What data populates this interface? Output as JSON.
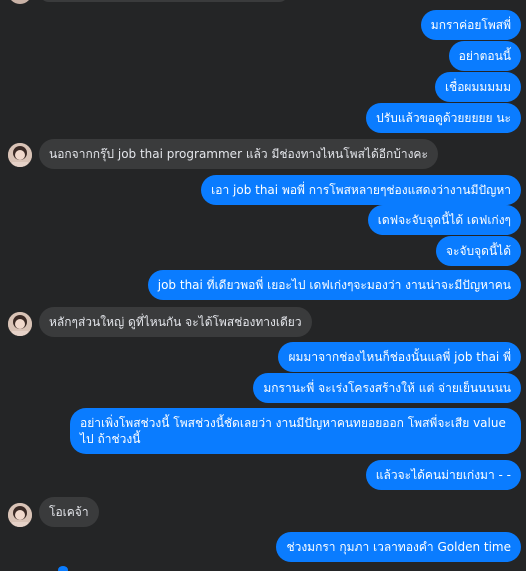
{
  "messages": [
    {
      "sender": "me",
      "text": "มกราค่อยโพสพี่"
    },
    {
      "sender": "me",
      "text": "อย่าตอนนี้"
    },
    {
      "sender": "me",
      "text": "เชื่อผมมมมม"
    },
    {
      "sender": "me",
      "text": "ปรับแล้วขอดูด้วยยยยย นะ"
    },
    {
      "sender": "them",
      "text": "นอกจากกรุ๊ป job thai programmer แล้ว มีช่องทางไหนโพสได้อีกบ้างคะ"
    },
    {
      "sender": "me",
      "text": "เอา job thai พอพี่ การโพสหลายๆช่องแสดงว่างานมีปัญหา"
    },
    {
      "sender": "me",
      "text": "เดฟจะจับจุดนี้ได้ เดฟเก่งๆ"
    },
    {
      "sender": "me",
      "text": "จะจับจุดนี้ได้"
    },
    {
      "sender": "me",
      "text": "job thai ที่เดียวพอพี่ เยอะไป เดฟเก่งๆจะมองว่า งานน่าจะมีปัญหาคน"
    },
    {
      "sender": "them",
      "text": "หลักๆส่วนใหญ่ ดูที่ไหนกัน จะได้โพสช่องทางเดียว"
    },
    {
      "sender": "me",
      "text": "ผมมาจากช่องไหนก็ช่องนั้นแลพี่ job thai พี่"
    },
    {
      "sender": "me",
      "text": "มกรานะพี่ จะเร่งโครงสร้างให้ แต่ จ่ายเย็นนนนน"
    },
    {
      "sender": "me",
      "text": "อย่าเพิ่งโพสช่วงนี้ โพสช่วงนี้ชัดเลยว่า งานมีปัญหาคนทยอยออก โพสพี่จะเสีย value ไป ถ้าช่วงนี้"
    },
    {
      "sender": "me",
      "text": "แล้วจะได้คนม่ายเก่งมา - -"
    },
    {
      "sender": "them",
      "text": "โอเคจ้า"
    },
    {
      "sender": "me",
      "text": "ช่วงมกรา กุมภา เวลาทองคำ Golden time"
    }
  ]
}
